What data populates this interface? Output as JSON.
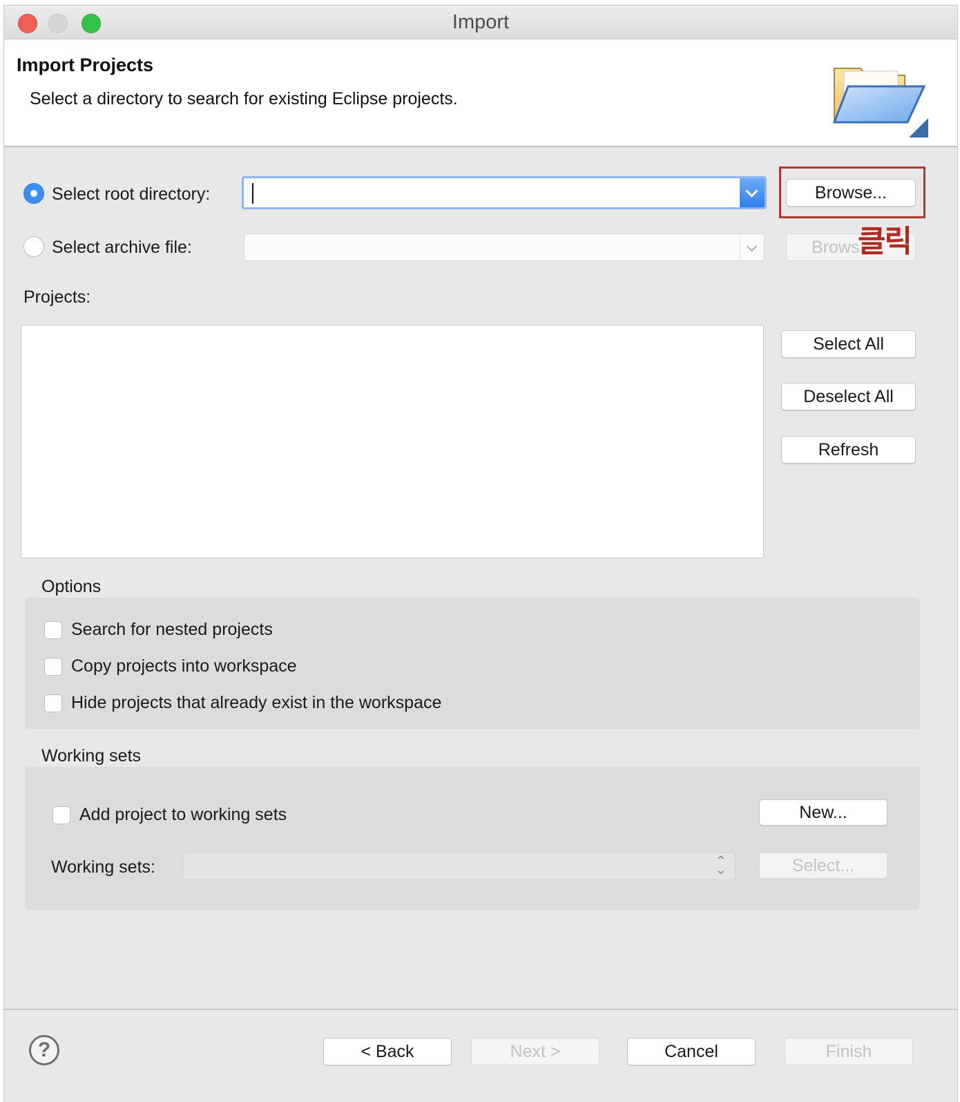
{
  "window": {
    "title": "Import"
  },
  "header": {
    "title": "Import Projects",
    "description": "Select a directory to search for existing Eclipse projects."
  },
  "source": {
    "root_directory_label": "Select root directory:",
    "root_directory_value": "",
    "archive_file_label": "Select archive file:",
    "archive_file_value": "",
    "browse_label": "Browse...",
    "browse_archive_label": "Brows",
    "selected": "root_directory"
  },
  "annotation": {
    "text": "클릭",
    "color": "#b4352c"
  },
  "projects": {
    "label": "Projects:",
    "items": [],
    "select_all_label": "Select All",
    "deselect_all_label": "Deselect All",
    "refresh_label": "Refresh"
  },
  "options": {
    "label": "Options",
    "items": [
      {
        "label": "Search for nested projects",
        "checked": false
      },
      {
        "label": "Copy projects into workspace",
        "checked": false
      },
      {
        "label": "Hide projects that already exist in the workspace",
        "checked": false
      }
    ]
  },
  "working_sets": {
    "group_label": "Working sets",
    "add_label": "Add project to working sets",
    "add_checked": false,
    "new_label": "New...",
    "field_label": "Working sets:",
    "field_value": "",
    "select_label": "Select..."
  },
  "footer": {
    "help_label": "?",
    "back_label": "< Back",
    "next_label": "Next >",
    "cancel_label": "Cancel",
    "finish_label": "Finish"
  },
  "colors": {
    "accent": "#3a8ff4",
    "window_bg": "#e8e8e8"
  }
}
